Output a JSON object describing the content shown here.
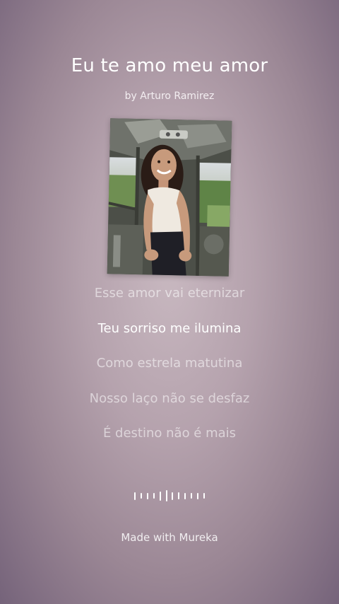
{
  "song": {
    "title": "Eu te amo meu amor",
    "artist": "by Arturo Ramirez"
  },
  "cover": {
    "icon": "album-cover-photo"
  },
  "lyrics": [
    {
      "text": "Esse amor vai eternizar",
      "active": false
    },
    {
      "text": "Teu sorriso me ilumina",
      "active": true
    },
    {
      "text": "Como estrela matutina",
      "active": false
    },
    {
      "text": "Nosso laço não se desfaz",
      "active": false
    },
    {
      "text": "É destino não é mais",
      "active": false
    }
  ],
  "waveform": {
    "icon": "audio-waveform-icon",
    "levels": [
      0.7,
      0.5,
      0.55,
      0.5,
      0.8,
      1.0,
      0.7,
      0.6,
      0.55,
      0.5,
      0.55,
      0.5
    ]
  },
  "footer": {
    "text": "Made with Mureka"
  },
  "colors": {
    "background_center": "#c8b8c0",
    "background_edge": "#75637a",
    "text": "#ffffff"
  }
}
